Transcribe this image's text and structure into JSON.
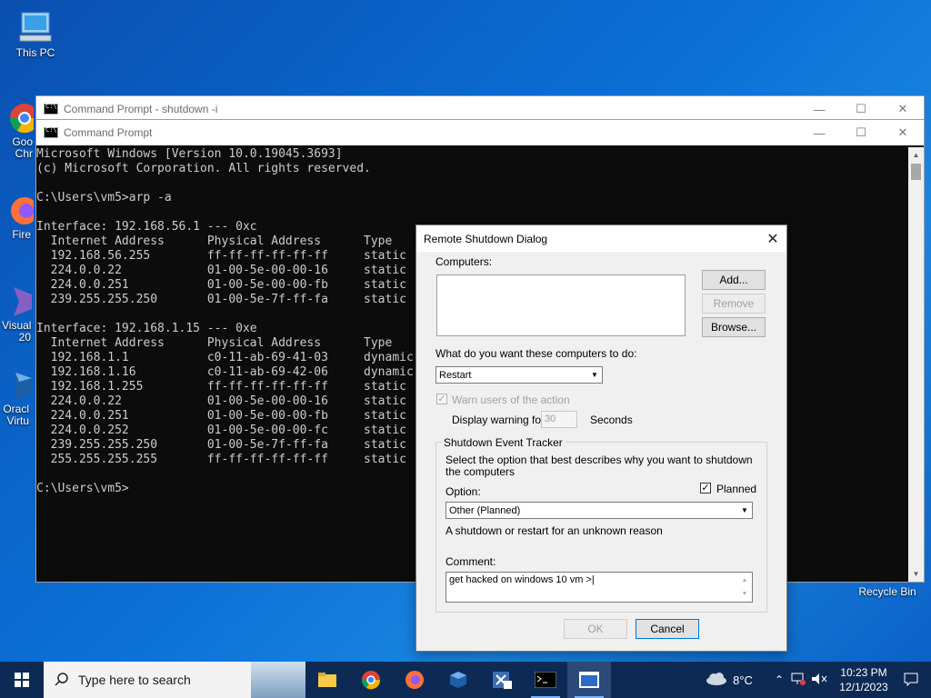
{
  "desktop": {
    "icons": [
      {
        "label": "This PC"
      },
      {
        "label": "Goo Chr"
      },
      {
        "label": "Fire"
      },
      {
        "label": "Visual 20"
      },
      {
        "label": "Oracl Virtu"
      },
      {
        "label": "Recycle Bin"
      }
    ]
  },
  "window_back": {
    "title": "Command Prompt - shutdown  -i"
  },
  "window_main": {
    "title": "Command Prompt"
  },
  "console": {
    "text": "Microsoft Windows [Version 10.0.19045.3693]\n(c) Microsoft Corporation. All rights reserved.\n\nC:\\Users\\vm5>arp -a\n\nInterface: 192.168.56.1 --- 0xc\n  Internet Address      Physical Address      Type\n  192.168.56.255        ff-ff-ff-ff-ff-ff     static\n  224.0.0.22            01-00-5e-00-00-16     static\n  224.0.0.251           01-00-5e-00-00-fb     static\n  239.255.255.250       01-00-5e-7f-ff-fa     static\n\nInterface: 192.168.1.15 --- 0xe\n  Internet Address      Physical Address      Type\n  192.168.1.1           c0-11-ab-69-41-03     dynamic\n  192.168.1.16          c0-11-ab-69-42-06     dynamic\n  192.168.1.255         ff-ff-ff-ff-ff-ff     static\n  224.0.0.22            01-00-5e-00-00-16     static\n  224.0.0.251           01-00-5e-00-00-fb     static\n  224.0.0.252           01-00-5e-00-00-fc     static\n  239.255.255.250       01-00-5e-7f-ff-fa     static\n  255.255.255.255       ff-ff-ff-ff-ff-ff     static\n\nC:\\Users\\vm5>"
  },
  "dialog": {
    "title": "Remote Shutdown Dialog",
    "computers_label": "Computers:",
    "add_label": "Add...",
    "remove_label": "Remove",
    "browse_label": "Browse...",
    "action_question": "What do you want these computers to do:",
    "action_value": "Restart",
    "warn_label": "Warn users of the action",
    "display_warning_label": "Display warning for",
    "warning_seconds": "30",
    "seconds_label": "Seconds",
    "tracker_legend": "Shutdown Event Tracker",
    "tracker_desc": "Select the option that best describes why you want to shutdown the computers",
    "option_label": "Option:",
    "planned_label": "Planned",
    "option_value": "Other (Planned)",
    "option_desc": "A shutdown or restart for an unknown reason",
    "comment_label": "Comment:",
    "comment_value": "get hacked on windows 10 vm >|",
    "ok_label": "OK",
    "cancel_label": "Cancel"
  },
  "taskbar": {
    "search_placeholder": "Type here to search",
    "weather": "8°C",
    "time": "10:23 PM",
    "date": "12/1/2023"
  }
}
